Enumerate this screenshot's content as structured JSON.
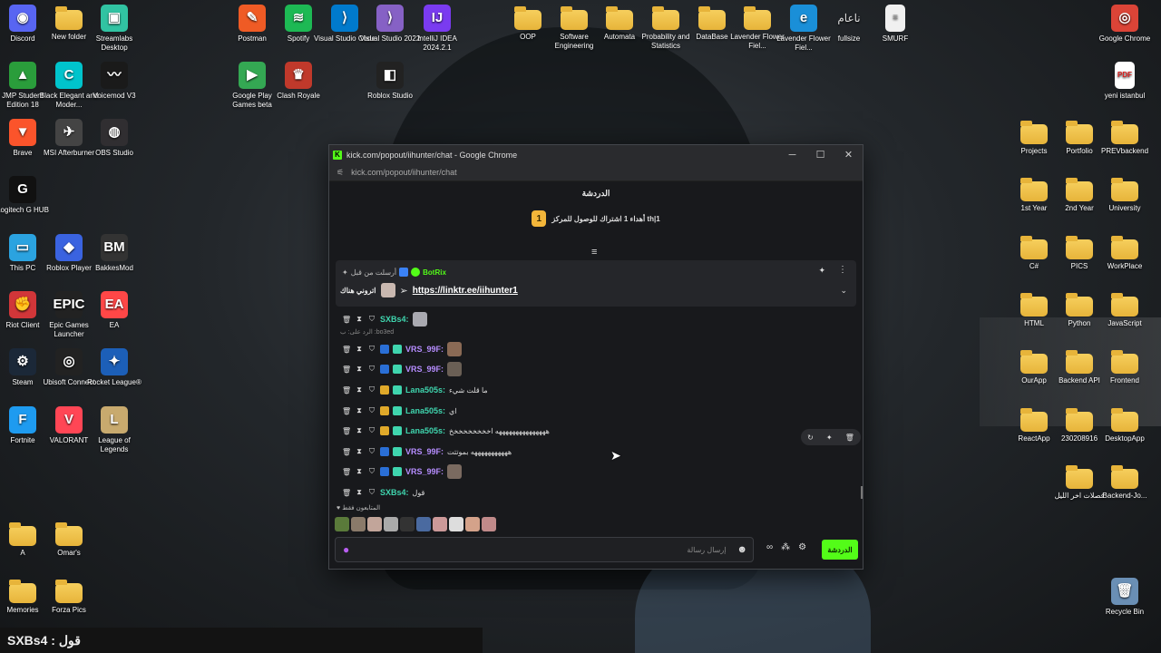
{
  "desktop": {
    "icons": [
      {
        "label": "Discord",
        "icon": "discord-icon",
        "color": "#5865f2",
        "glyph": "◉"
      },
      {
        "label": "New folder",
        "icon": "folder-icon",
        "color": "",
        "glyph": ""
      },
      {
        "label": "Streamlabs Desktop",
        "icon": "streamlabs-icon",
        "color": "#31c3a2",
        "glyph": "▣"
      },
      {
        "label": "Postman",
        "icon": "postman-icon",
        "color": "#ef5b25",
        "glyph": "✎"
      },
      {
        "label": "Spotify",
        "icon": "spotify-icon",
        "color": "#1db954",
        "glyph": "≋"
      },
      {
        "label": "Visual Studio Code",
        "icon": "vscode-icon",
        "color": "#007acc",
        "glyph": "⟩"
      },
      {
        "label": "Visual Studio 2022",
        "icon": "visual-studio-icon",
        "color": "#8661c5",
        "glyph": "⟩"
      },
      {
        "label": "IntelliJ IDEA 2024.2.1",
        "icon": "intellij-icon",
        "color": "#7a3bf0",
        "glyph": "IJ"
      },
      {
        "label": "OOP",
        "icon": "folder-icon",
        "color": "",
        "glyph": ""
      },
      {
        "label": "Software Engineering",
        "icon": "folder-icon",
        "color": "",
        "glyph": ""
      },
      {
        "label": "Automata",
        "icon": "folder-icon",
        "color": "",
        "glyph": ""
      },
      {
        "label": "Probability and Statistics",
        "icon": "folder-icon",
        "color": "",
        "glyph": ""
      },
      {
        "label": "DataBase",
        "icon": "folder-icon",
        "color": "",
        "glyph": ""
      },
      {
        "label": "Lavender Flower Fiel...",
        "icon": "folder-icon",
        "color": "",
        "glyph": ""
      },
      {
        "label": "Lavender Flower Fiel...",
        "icon": "edge-icon",
        "color": "#1a8fd8",
        "glyph": "e"
      },
      {
        "label": "fullsize",
        "icon": "text-icon",
        "color": "transparent",
        "glyph": "ناعام"
      },
      {
        "label": "SMURF",
        "icon": "file-icon",
        "color": "",
        "glyph": "≡"
      },
      {
        "label": "Google Chrome",
        "icon": "chrome-icon",
        "color": "#db4437",
        "glyph": "◎"
      },
      {
        "label": "JMP Student Edition 18",
        "icon": "jmp-icon",
        "color": "#2a9d3b",
        "glyph": "▲"
      },
      {
        "label": "Black Elegant and Moder...",
        "icon": "canva-icon",
        "color": "#00c4cc",
        "glyph": "C"
      },
      {
        "label": "Voicemod V3",
        "icon": "voicemod-icon",
        "color": "#1a1a1a",
        "glyph": "〰"
      },
      {
        "label": "Google Play Games beta",
        "icon": "play-games-icon",
        "color": "#34a853",
        "glyph": "▶"
      },
      {
        "label": "Clash Royale",
        "icon": "clash-royale-icon",
        "color": "#c0392b",
        "glyph": "♛"
      },
      {
        "label": "Roblox Studio",
        "icon": "roblox-studio-icon",
        "color": "#222",
        "glyph": "◧"
      },
      {
        "label": "yeni istanbul",
        "icon": "pdf-icon",
        "color": "",
        "glyph": "PDF"
      },
      {
        "label": "Brave",
        "icon": "brave-icon",
        "color": "#fb542b",
        "glyph": "▼"
      },
      {
        "label": "MSI Afterburner",
        "icon": "msi-icon",
        "color": "#444",
        "glyph": "✈"
      },
      {
        "label": "OBS Studio",
        "icon": "obs-icon",
        "color": "#302e31",
        "glyph": "◍"
      },
      {
        "label": "Projects",
        "icon": "folder-icon",
        "color": "",
        "glyph": ""
      },
      {
        "label": "Portfolio",
        "icon": "folder-icon",
        "color": "",
        "glyph": ""
      },
      {
        "label": "PREVbackend",
        "icon": "folder-icon",
        "color": "",
        "glyph": ""
      },
      {
        "label": "Logitech G HUB",
        "icon": "logitech-icon",
        "color": "#111",
        "glyph": "G"
      },
      {
        "label": "1st Year",
        "icon": "folder-icon",
        "color": "",
        "glyph": ""
      },
      {
        "label": "2nd Year",
        "icon": "folder-icon",
        "color": "",
        "glyph": ""
      },
      {
        "label": "University",
        "icon": "folder-icon",
        "color": "",
        "glyph": ""
      },
      {
        "label": "This PC",
        "icon": "this-pc-icon",
        "color": "#2ba3e0",
        "glyph": "▭"
      },
      {
        "label": "Roblox Player",
        "icon": "roblox-icon",
        "color": "#3a63e0",
        "glyph": "◆"
      },
      {
        "label": "BakkesMod",
        "icon": "bakkesmod-icon",
        "color": "#333",
        "glyph": "BM"
      },
      {
        "label": "C#",
        "icon": "folder-icon",
        "color": "",
        "glyph": ""
      },
      {
        "label": "PICS",
        "icon": "folder-icon",
        "color": "",
        "glyph": ""
      },
      {
        "label": "WorkPlace",
        "icon": "folder-icon",
        "color": "",
        "glyph": ""
      },
      {
        "label": "Riot Client",
        "icon": "riot-icon",
        "color": "#d13639",
        "glyph": "✊"
      },
      {
        "label": "Epic Games Launcher",
        "icon": "epic-games-icon",
        "color": "#222",
        "glyph": "EPIC"
      },
      {
        "label": "EA",
        "icon": "ea-icon",
        "color": "#ff4747",
        "glyph": "EA"
      },
      {
        "label": "HTML",
        "icon": "folder-icon",
        "color": "",
        "glyph": ""
      },
      {
        "label": "Python",
        "icon": "folder-icon",
        "color": "",
        "glyph": ""
      },
      {
        "label": "JavaScript",
        "icon": "folder-icon",
        "color": "",
        "glyph": ""
      },
      {
        "label": "Steam",
        "icon": "steam-icon",
        "color": "#1b2838",
        "glyph": "⚙"
      },
      {
        "label": "Ubisoft Connect",
        "icon": "ubisoft-icon",
        "color": "#222",
        "glyph": "◎"
      },
      {
        "label": "Rocket League®",
        "icon": "rocket-league-icon",
        "color": "#1c5fb8",
        "glyph": "✦"
      },
      {
        "label": "OurApp",
        "icon": "folder-icon",
        "color": "",
        "glyph": ""
      },
      {
        "label": "Backend API",
        "icon": "folder-icon",
        "color": "",
        "glyph": ""
      },
      {
        "label": "Frontend",
        "icon": "folder-icon",
        "color": "",
        "glyph": ""
      },
      {
        "label": "Fortnite",
        "icon": "fortnite-icon",
        "color": "#1e9bf0",
        "glyph": "F"
      },
      {
        "label": "VALORANT",
        "icon": "valorant-icon",
        "color": "#ff4655",
        "glyph": "V"
      },
      {
        "label": "League of Legends",
        "icon": "league-icon",
        "color": "#c8aa6e",
        "glyph": "L"
      },
      {
        "label": "ReactApp",
        "icon": "folder-icon",
        "color": "",
        "glyph": ""
      },
      {
        "label": "230208916",
        "icon": "folder-icon",
        "color": "",
        "glyph": ""
      },
      {
        "label": "DesktopApp",
        "icon": "folder-icon",
        "color": "",
        "glyph": ""
      },
      {
        "label": "فصلات اخر الليل",
        "icon": "folder-icon",
        "color": "",
        "glyph": ""
      },
      {
        "label": "Backend-Jo...",
        "icon": "folder-icon",
        "color": "",
        "glyph": ""
      },
      {
        "label": "A",
        "icon": "folder-icon",
        "color": "",
        "glyph": ""
      },
      {
        "label": "Omar's",
        "icon": "folder-icon",
        "color": "",
        "glyph": ""
      },
      {
        "label": "Memories",
        "icon": "folder-icon",
        "color": "",
        "glyph": ""
      },
      {
        "label": "Forza Pics",
        "icon": "folder-icon",
        "color": "",
        "glyph": ""
      },
      {
        "label": "Recycle Bin",
        "icon": "recycle-bin-icon",
        "color": "#6a8fb5",
        "glyph": "🗑"
      }
    ]
  },
  "window": {
    "title": "kick.com/popout/iihunter/chat - Google Chrome",
    "url": "kick.com/popout/iihunter/chat",
    "controls": {
      "minimize": "─",
      "maximize": "☐",
      "close": "✕"
    }
  },
  "chat": {
    "header": "الدردشة",
    "goal_rank": "1",
    "goal_text": "أهداء 1 اشتراك للوصول للمركز th|1",
    "pinned": {
      "meta": "أرسلت من قبل",
      "bot": "BotRix",
      "link": "https://linktr.ee/iihunter1",
      "caption": "اتروني هناك"
    },
    "reply_hint": "الرد على: ب :bo3ed",
    "messages": [
      {
        "user": "SXBs4:",
        "text": "",
        "color": "ucyan"
      },
      {
        "user": "VRS_99F:",
        "text": "",
        "color": "upurple"
      },
      {
        "user": "VRS_99F:",
        "text": "",
        "color": "upurple"
      },
      {
        "user": "Lana505s:",
        "text": "ما قلت شيء",
        "color": "ucyan"
      },
      {
        "user": "Lana505s:",
        "text": "اي",
        "color": "ucyan"
      },
      {
        "user": "Lana505s:",
        "text": "هههههههههههههههه اخخخخخخخخخ",
        "color": "ucyan"
      },
      {
        "user": "VRS_99F:",
        "text": "هههههههههههه بموتتت",
        "color": "upurple"
      },
      {
        "user": "VRS_99F:",
        "text": "",
        "color": "upurple"
      },
      {
        "user": "SXBs4:",
        "text": "قول",
        "color": "ucyan"
      }
    ],
    "supporters_label": "المتابعون فقط",
    "input_placeholder": "إرسال رسالة",
    "send_label": "الدردشة"
  },
  "overlay": {
    "caption": "SXBs4 : قول"
  }
}
